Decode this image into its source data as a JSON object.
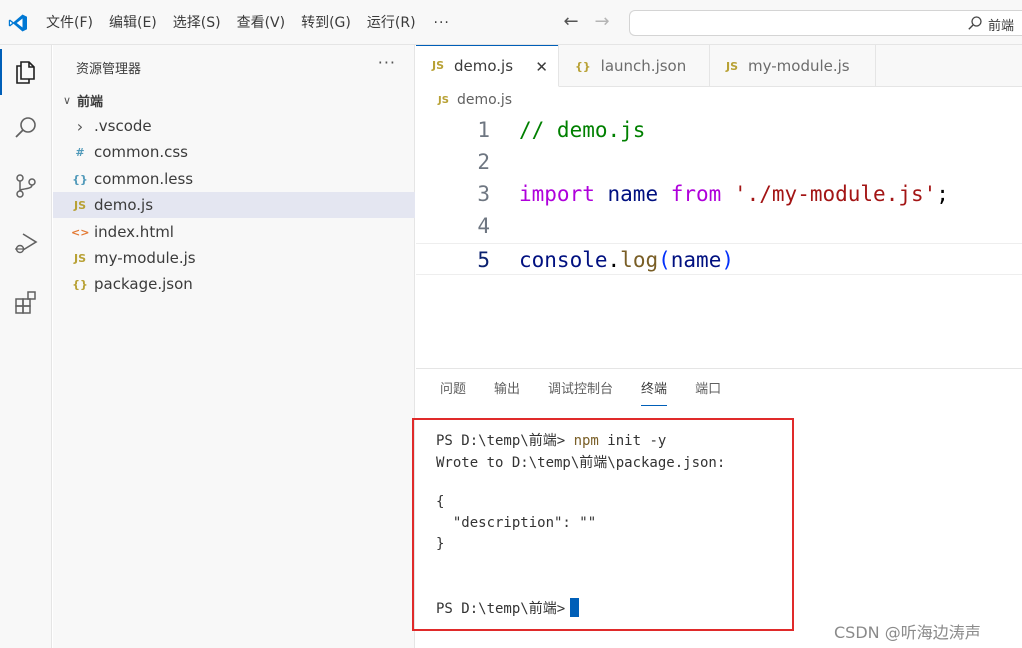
{
  "titlebar": {
    "menu": [
      "文件(F)",
      "编辑(E)",
      "选择(S)",
      "查看(V)",
      "转到(G)",
      "运行(R)"
    ],
    "more": "···",
    "search_label": "前端"
  },
  "activity": [
    "explorer-icon",
    "search-icon",
    "source-control-icon",
    "run-debug-icon",
    "extensions-icon"
  ],
  "sidebar": {
    "title": "资源管理器",
    "more": "···",
    "folder": "前端",
    "items": [
      {
        "icon": "›",
        "label": ".vscode",
        "color": "#555555"
      },
      {
        "icon": "#",
        "label": "common.css",
        "color": "#519aba"
      },
      {
        "icon": "{}",
        "label": "common.less",
        "color": "#519aba"
      },
      {
        "icon": "JS",
        "label": "demo.js",
        "color": "#b8a135"
      },
      {
        "icon": "<>",
        "label": "index.html",
        "color": "#e37933"
      },
      {
        "icon": "JS",
        "label": "my-module.js",
        "color": "#b8a135"
      },
      {
        "icon": "{}",
        "label": "package.json",
        "color": "#b8a135"
      }
    ]
  },
  "editor": {
    "tabs": [
      {
        "icon": "JS",
        "label": "demo.js",
        "close": "✕"
      },
      {
        "icon": "{}",
        "label": "launch.json"
      },
      {
        "icon": "JS",
        "label": "my-module.js"
      }
    ],
    "breadcrumb": {
      "icon": "JS",
      "label": "demo.js"
    },
    "lines": [
      {
        "n": "1",
        "tokens": [
          {
            "t": "// demo.js",
            "c": "comment"
          }
        ]
      },
      {
        "n": "2",
        "tokens": []
      },
      {
        "n": "3",
        "tokens": [
          {
            "t": "import",
            "c": "kw"
          },
          {
            "t": " ",
            "c": "plain"
          },
          {
            "t": "name",
            "c": "var"
          },
          {
            "t": " ",
            "c": "plain"
          },
          {
            "t": "from",
            "c": "kw"
          },
          {
            "t": " ",
            "c": "plain"
          },
          {
            "t": "'./my-module.js'",
            "c": "str"
          },
          {
            "t": ";",
            "c": "plain"
          }
        ]
      },
      {
        "n": "4",
        "tokens": []
      },
      {
        "n": "5",
        "tokens": [
          {
            "t": "console",
            "c": "var"
          },
          {
            "t": ".",
            "c": "plain"
          },
          {
            "t": "log",
            "c": "fn"
          },
          {
            "t": "(",
            "c": "paren"
          },
          {
            "t": "name",
            "c": "var"
          },
          {
            "t": ")",
            "c": "paren"
          }
        ]
      }
    ]
  },
  "panel": {
    "tabs": [
      "问题",
      "输出",
      "调试控制台",
      "终端",
      "端口"
    ],
    "terminal": {
      "prompt": "PS D:\\temp\\前端> ",
      "cmd": "npm",
      "args": " init -y",
      "out1": "Wrote to D:\\temp\\前端\\package.json:",
      "out2": "{",
      "out3": "  \"description\": \"\"",
      "out4": "}",
      "prompt2": "PS D:\\temp\\前端>"
    }
  },
  "watermark": "CSDN @听海边涛声"
}
